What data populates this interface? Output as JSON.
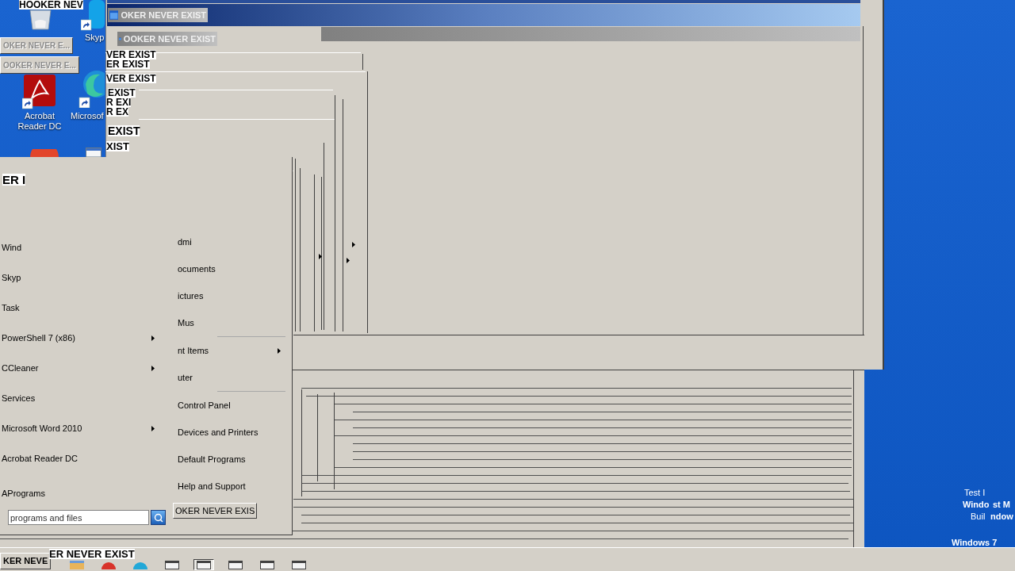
{
  "desktop": {
    "icons": [
      {
        "kind": "recycle-bin"
      },
      {
        "kind": "skype",
        "label": "Skyp"
      },
      {
        "kind": "acrobat",
        "label": "Acrobat Reader DC"
      },
      {
        "kind": "edge",
        "label": "Microsof"
      },
      {
        "kind": "firefox"
      },
      {
        "kind": "document"
      }
    ],
    "test_mode_text": [
      "Test I",
      "Windo",
      "st M",
      "Buil",
      "ndow",
      "Windows 7"
    ]
  },
  "title_bars": [
    {
      "active": true
    },
    {
      "active": false
    },
    {
      "title": "OKER NEVER EXIST",
      "active": false
    },
    {
      "title": "OOKER NEVER EXIST",
      "active": false
    }
  ],
  "fragments": [
    {
      "kind": "label",
      "text": "HOOKER NEV"
    },
    {
      "kind": "button",
      "text": "OKER NEVER E..."
    },
    {
      "kind": "button",
      "text": "OOKER NEVER E..."
    },
    {
      "kind": "label",
      "text": "VER EXIST"
    },
    {
      "kind": "label",
      "text": "ER EXIST"
    },
    {
      "kind": "label",
      "text": "VER EXIST"
    },
    {
      "kind": "label",
      "text": "EXIST"
    },
    {
      "kind": "label",
      "text": "R EXI"
    },
    {
      "kind": "label",
      "text": "R EX"
    },
    {
      "kind": "label",
      "text": "EXIST"
    },
    {
      "kind": "label",
      "text": "XIST"
    },
    {
      "kind": "label",
      "text": "ER I"
    },
    {
      "kind": "label",
      "text": "ER NEVER EXIST"
    }
  ],
  "start_menu": {
    "programs": [
      {
        "label": "Wind",
        "submenu": false
      },
      {
        "label": "Skyp",
        "submenu": false
      },
      {
        "label": "Task",
        "submenu": false
      },
      {
        "label": "PowerShell 7 (x86)",
        "submenu": true
      },
      {
        "label": "CCleaner",
        "submenu": true
      },
      {
        "label": "Services",
        "submenu": false
      },
      {
        "label": "Microsoft Word 2010",
        "submenu": true
      },
      {
        "label": "Acrobat Reader DC",
        "submenu": false
      }
    ],
    "all_programs": "APrograms",
    "search": {
      "placeholder": "programs and files"
    },
    "place_groups": [
      {
        "items": [
          {
            "label": "dmi",
            "submenu": false
          },
          {
            "label": "ocuments",
            "submenu": false
          },
          {
            "label": "ictures",
            "submenu": false
          },
          {
            "label": "Mus",
            "submenu": false
          }
        ]
      },
      {
        "items": [
          {
            "label": "nt Items",
            "submenu": true
          },
          {
            "label": "uter",
            "submenu": false
          }
        ]
      },
      {
        "items": [
          {
            "label": "Control Panel",
            "submenu": false
          },
          {
            "label": "Devices and Printers",
            "submenu": false
          },
          {
            "label": "Default Programs",
            "submenu": false
          },
          {
            "label": "Help and Support",
            "submenu": false
          }
        ]
      }
    ],
    "button": "OKER NEVER EXIS"
  },
  "taskbar": {
    "button": "KER NEVE",
    "icons": [
      {
        "kind": "folder",
        "selected": false
      },
      {
        "kind": "red-app",
        "selected": false
      },
      {
        "kind": "blue-app",
        "selected": false
      },
      {
        "kind": "window",
        "selected": false
      },
      {
        "kind": "window",
        "selected": true
      },
      {
        "kind": "window",
        "selected": false
      },
      {
        "kind": "window",
        "selected": false
      },
      {
        "kind": "window",
        "selected": false
      }
    ]
  }
}
